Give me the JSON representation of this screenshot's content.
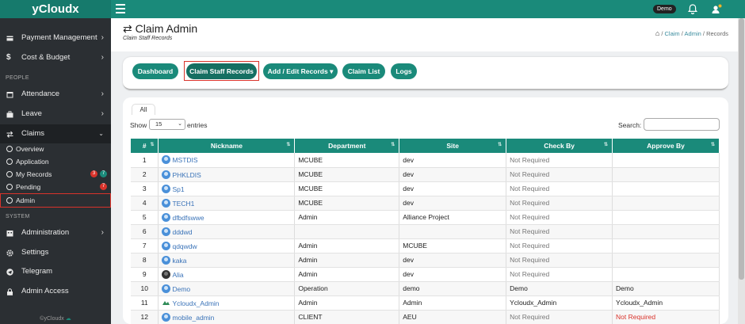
{
  "app": {
    "brand": "yCloudx",
    "user": "Demo"
  },
  "sidebar": {
    "items_top": [
      {
        "label": "Payment Management",
        "icon": "card-icon"
      },
      {
        "label": "Cost & Budget",
        "icon": "dollar-icon"
      }
    ],
    "section_people": "PEOPLE",
    "items_people": [
      {
        "label": "Attendance",
        "icon": "calendar-icon"
      },
      {
        "label": "Leave",
        "icon": "briefcase-icon"
      },
      {
        "label": "Claims",
        "icon": "exchange-icon"
      }
    ],
    "claims_sub": [
      {
        "label": "Overview"
      },
      {
        "label": "Application"
      },
      {
        "label": "My Records",
        "badge1": "3",
        "badge2": "7"
      },
      {
        "label": "Pending",
        "badge1": "7"
      },
      {
        "label": "Admin"
      }
    ],
    "section_system": "SYSTEM",
    "items_system": [
      {
        "label": "Administration",
        "icon": "building-icon"
      },
      {
        "label": "Settings",
        "icon": "gear-icon"
      },
      {
        "label": "Telegram",
        "icon": "telegram-icon"
      },
      {
        "label": "Admin Access",
        "icon": "lock-icon"
      }
    ],
    "footer": "©yCloudx"
  },
  "header": {
    "title": "Claim Admin",
    "subtitle": "Claim Staff Records",
    "breadcrumb": [
      "Claim",
      "Admin",
      "Records"
    ]
  },
  "buttons": {
    "dashboard": "Dashboard",
    "staff_records": "Claim Staff Records",
    "add_edit": "Add / Edit Records",
    "claim_list": "Claim List",
    "logs": "Logs"
  },
  "table_controls": {
    "tab_all": "All",
    "show": "Show",
    "page_size": "15",
    "entries": "entries",
    "search": "Search:",
    "search_value": ""
  },
  "table": {
    "columns": [
      "#",
      "Nickname",
      "Department",
      "Site",
      "Check By",
      "Approve By"
    ],
    "rows": [
      {
        "n": "1",
        "nick": "MSTDIS",
        "avatar": "default",
        "dept": "MCUBE",
        "site": "dev",
        "check": "Not Required",
        "approve": ""
      },
      {
        "n": "2",
        "nick": "PHKLDIS",
        "avatar": "default",
        "dept": "MCUBE",
        "site": "dev",
        "check": "Not Required",
        "approve": ""
      },
      {
        "n": "3",
        "nick": "Sp1",
        "avatar": "default",
        "dept": "MCUBE",
        "site": "dev",
        "check": "Not Required",
        "approve": ""
      },
      {
        "n": "4",
        "nick": "TECH1",
        "avatar": "default",
        "dept": "MCUBE",
        "site": "dev",
        "check": "Not Required",
        "approve": ""
      },
      {
        "n": "5",
        "nick": "dfbdfswwe",
        "avatar": "default",
        "dept": "Admin",
        "site": "Alliance Project",
        "check": "Not Required",
        "approve": ""
      },
      {
        "n": "6",
        "nick": "dddwd",
        "avatar": "default",
        "dept": "",
        "site": "",
        "check": "Not Required",
        "approve": ""
      },
      {
        "n": "7",
        "nick": "qdqwdw",
        "avatar": "default",
        "dept": "Admin",
        "site": "MCUBE",
        "check": "Not Required",
        "approve": ""
      },
      {
        "n": "8",
        "nick": "kaka",
        "avatar": "default",
        "dept": "Admin",
        "site": "dev",
        "check": "Not Required",
        "approve": ""
      },
      {
        "n": "9",
        "nick": "Alia",
        "avatar": "photo",
        "dept": "Admin",
        "site": "dev",
        "check": "Not Required",
        "approve": ""
      },
      {
        "n": "10",
        "nick": "Demo",
        "avatar": "default",
        "dept": "Operation",
        "site": "demo",
        "check": "Demo",
        "approve": "Demo"
      },
      {
        "n": "11",
        "nick": "Ycloudx_Admin",
        "avatar": "logo",
        "dept": "Admin",
        "site": "Admin",
        "check": "Ycloudx_Admin",
        "approve": "Ycloudx_Admin"
      },
      {
        "n": "12",
        "nick": "mobile_admin",
        "avatar": "default",
        "dept": "CLIENT",
        "site": "AEU",
        "check": "Not Required",
        "approve": "Not Required",
        "approve_red": true
      }
    ]
  },
  "colors": {
    "accent": "#1a8a7a",
    "sidebar": "#2b2f33",
    "highlight": "#d9332b"
  }
}
